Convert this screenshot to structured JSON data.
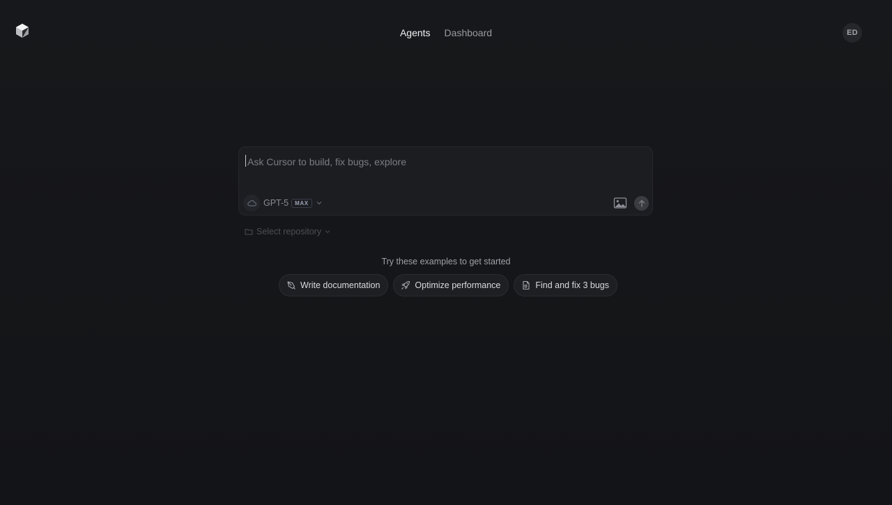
{
  "nav": {
    "agents_label": "Agents",
    "dashboard_label": "Dashboard",
    "active": "agents"
  },
  "user": {
    "initials": "ED"
  },
  "composer": {
    "placeholder": "Ask Cursor to build, fix bugs, explore",
    "value": "",
    "model_name": "GPT-5",
    "model_badge": "MAX",
    "environment_icon": "cloud-icon",
    "attach_icon": "image-icon",
    "send_icon": "arrow-up-icon"
  },
  "repository": {
    "label": "Select repository",
    "icon": "folder-icon"
  },
  "examples": {
    "title": "Try these examples to get started",
    "items": [
      {
        "label": "Write documentation",
        "icon": "pen-nib-icon"
      },
      {
        "label": "Optimize performance",
        "icon": "rocket-icon"
      },
      {
        "label": "Find and fix 3 bugs",
        "icon": "file-bug-icon"
      }
    ]
  },
  "colors": {
    "background": "#141518",
    "surface": "#1c1d21",
    "text_primary": "#f2f2f4",
    "text_muted": "#9a9ba1"
  }
}
